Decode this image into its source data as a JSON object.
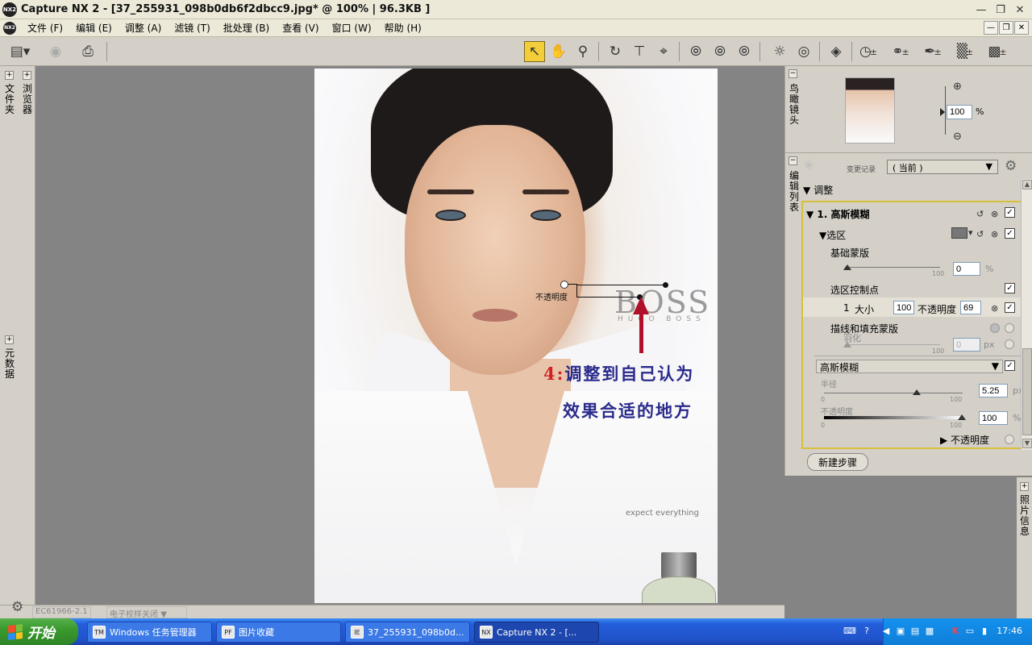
{
  "titlebar": {
    "logo": "NX2",
    "title": "Capture  NX 2  -  [37_255931_098b0db6f2dbcc9.jpg* @ 100%  |  96.3KB  ]",
    "buttons": [
      "minimize",
      "restore",
      "close"
    ]
  },
  "menubar": {
    "logo": "NX2",
    "items": [
      "文件 (F)",
      "编辑 (E)",
      "调整 (A)",
      "滤镜 (T)",
      "批处理 (B)",
      "查看 (V)",
      "窗口 (W)",
      "帮助 (H)"
    ]
  },
  "toolbar": {
    "icons": [
      "browser-layout-icon",
      "camera-icon",
      "print-icon",
      "direct-select-icon",
      "hand-icon",
      "zoom-icon",
      "rotate-icon",
      "straighten-icon",
      "crop-icon",
      "black-control-point-icon",
      "neutral-control-point-icon",
      "white-control-point-icon",
      "red-eye-icon",
      "color-point-icon",
      "eye-icon",
      "lasso-icon",
      "brush-icon",
      "gradient-icon",
      "fill-icon"
    ]
  },
  "left_dock": {
    "tabs": [
      "文件夹",
      "浏览器",
      "元数据"
    ]
  },
  "canvas": {
    "photo_alt": "BOSS advertisement portrait",
    "boss_text": "BOSS",
    "hugo_text": "HUGO BOSS",
    "tagline": "expect everything",
    "control_point_label": "不透明度",
    "annotation": {
      "step_number": "4:",
      "line1": "调整到自己认为",
      "line2": "效果合适的地方"
    }
  },
  "birdseye_panel": {
    "tab_label": "鸟瞰镜头",
    "zoom_value": "100",
    "zoom_unit": "%"
  },
  "edit_list_panel": {
    "tab_label": "编辑列表",
    "history_label": "变更记录",
    "history_value": "( 当前 )",
    "adjust_header": "调整",
    "step_title": "1. 高斯模糊",
    "selection_label": "选区",
    "base_mask_label": "基础蒙版",
    "base_mask_value": "0",
    "base_mask_unit": "%",
    "base_mask_max": "100",
    "selection_cp_label": "选区控制点",
    "cp_row": {
      "index": "1",
      "size_label": "大小",
      "size_value": "100",
      "opacity_label": "不透明度",
      "opacity_value": "69"
    },
    "stroke_fill_label": "描线和填充蒙版",
    "feather_label": "羽化",
    "feather_value": "0",
    "feather_unit": "px",
    "feather_max": "100",
    "filter_select": "高斯模糊",
    "radius_label": "半径",
    "radius_min": "0",
    "radius_max": "100",
    "radius_value": "5.25",
    "radius_unit": "px",
    "opacity_label": "不透明度",
    "opacity_min": "0",
    "opacity_max": "100",
    "opacity_value": "100",
    "opacity_unit": "%",
    "opacity_radio_label": "不透明度",
    "new_step_button": "新建步骤"
  },
  "photo_info_tab": "照片信息",
  "statusbar": {
    "left_text": "EC61966-2.1",
    "right_text": "电子校样关闭"
  },
  "taskbar": {
    "start_label": "开始",
    "tasks": [
      {
        "label": "Windows 任务管理器",
        "icon": "TM"
      },
      {
        "label": "图片收藏",
        "icon": "PF"
      },
      {
        "label": "37_255931_098b0d...",
        "icon": "IE"
      },
      {
        "label": "Capture NX 2 - [...",
        "icon": "NX"
      }
    ],
    "clock": "17:46"
  },
  "colors": {
    "accent_yellow": "#f4ce3a",
    "edit_box_border": "#d8bf3a",
    "annotation_blue": "#2a2a8c",
    "annotation_red": "#d02020",
    "arrow_red": "#b0102a",
    "taskbar_blue": "#245edc",
    "start_green": "#3a9a2f"
  }
}
